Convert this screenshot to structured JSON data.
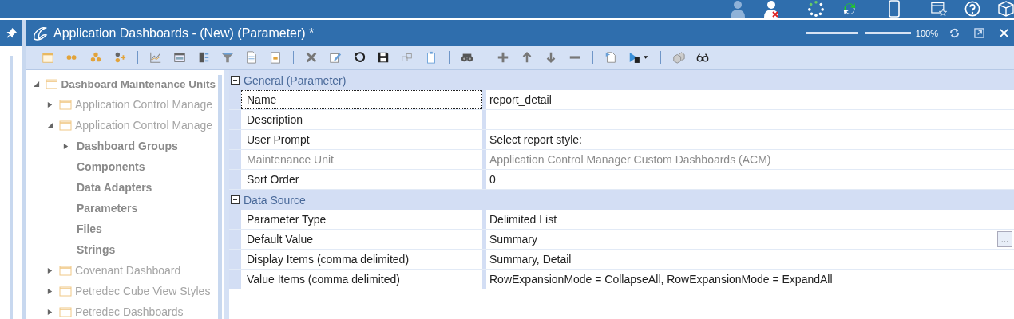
{
  "window": {
    "title": "Application Dashboards - (New) (Parameter) *",
    "zoom": {
      "level": 0.5,
      "label": "100%"
    }
  },
  "tree": [
    {
      "label": "Dashboard Maintenance Units",
      "kind": "root",
      "expanded": true,
      "children": [
        {
          "label": "Application Control Manage",
          "kind": "folder",
          "expanded": false
        },
        {
          "label": "Application Control Manage",
          "kind": "folder",
          "expanded": true,
          "children": [
            {
              "label": "Dashboard Groups",
              "kind": "category",
              "expanded": false
            },
            {
              "label": "Components",
              "kind": "category"
            },
            {
              "label": "Data Adapters",
              "kind": "category"
            },
            {
              "label": "Parameters",
              "kind": "category"
            },
            {
              "label": "Files",
              "kind": "category"
            },
            {
              "label": "Strings",
              "kind": "category"
            }
          ]
        },
        {
          "label": "Covenant Dashboard",
          "kind": "folder",
          "expanded": false
        },
        {
          "label": "Petredec Cube View Styles",
          "kind": "folder",
          "expanded": false
        },
        {
          "label": "Petredec Dashboards",
          "kind": "folder",
          "expanded": false
        }
      ]
    }
  ],
  "properties": [
    {
      "section": "General (Parameter)",
      "expanded": true,
      "rows": [
        {
          "label": "Name",
          "value": "report_detail",
          "selected": true,
          "readonly": false
        },
        {
          "label": "Description",
          "selected": false,
          "readonly": false
        },
        {
          "label": "User Prompt",
          "value": "Select report style:",
          "selected": false,
          "readonly": false
        },
        {
          "label": "Maintenance Unit",
          "value": "Application Control Manager Custom Dashboards (ACM)",
          "selected": false,
          "readonly": true
        },
        {
          "label": "Sort Order",
          "value": "0",
          "selected": false,
          "readonly": false
        }
      ]
    },
    {
      "section": "Data Source",
      "expanded": true,
      "rows": [
        {
          "label": "Parameter Type",
          "value": "Delimited List",
          "selected": false,
          "readonly": false
        },
        {
          "label": "Default Value",
          "value": "Summary",
          "button": "...",
          "selected": false,
          "readonly": false
        },
        {
          "label": "Display Items (comma delimited)",
          "value": "Summary, Detail",
          "selected": false,
          "readonly": false
        },
        {
          "label": "Value Items (comma delimited)",
          "value": "RowExpansionMode = CollapseAll, RowExpansionMode = ExpandAll",
          "selected": false,
          "readonly": false
        }
      ]
    }
  ]
}
